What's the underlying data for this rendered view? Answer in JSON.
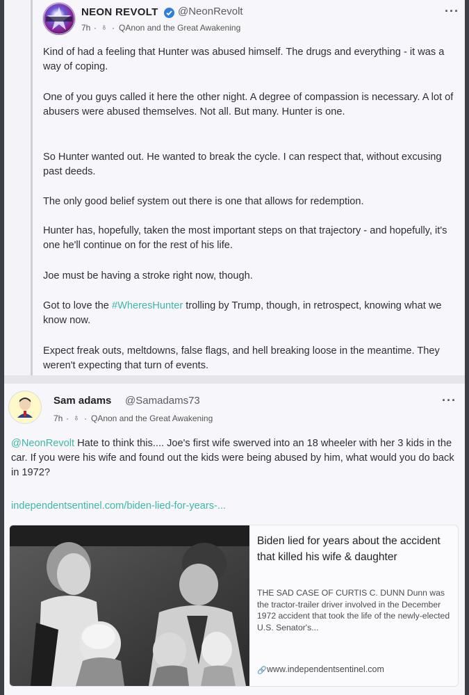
{
  "post1": {
    "author_name": "NEON REVOLT",
    "handle": "@NeonRevolt",
    "time": "7h",
    "separator": "·",
    "group": "QAnon and the Great Awakening",
    "more": "···",
    "paragraphs": [
      "Kind of had a feeling that Hunter was abused himself. The drugs and everything - it was a way of coping.",
      "One of you guys called it here the other night. A degree of compassion is necessary. A lot of abusers were abused themselves. Not all. But many. Hunter is one.",
      "So Hunter wanted out. He wanted to break the cycle. I can respect that, without excusing past deeds.",
      "The only good belief system out there is one that allows for redemption.",
      "Hunter has, hopefully, taken the most important steps on that trajectory - and hopefully, it's one he'll continue on for the rest of his life.",
      "Joe must be having a stroke right now, though."
    ],
    "p7_before": "Got to love the ",
    "p7_hashtag": "#WheresHunter",
    "p7_after": " trolling by Trump, though, in retrospect, knowing what we know now.",
    "p8": "Expect freak outs, meltdowns, false flags, and hell breaking loose in the meantime. They weren't expecting that turn of events."
  },
  "post2": {
    "author_name": "Sam adams",
    "handle": "@Samadams73",
    "time": "7h",
    "separator": "·",
    "group": "QAnon and the Great Awakening",
    "more": "···",
    "mention": "@NeonRevolt",
    "text": " Hate to think this.... Joe's first wife swerved into an 18 wheeler with her 3 kids in the car. If you were his wife and found out the kids were being abused by him, what would you do back in 1972?",
    "link": "independentsentinel.com/biden-lied-for-years-..."
  },
  "card": {
    "title": "Biden lied for years about the accident that killed his wife & daughter",
    "description": "THE SAD CASE OF CURTIS C. DUNN Dunn was the tractor-trailer driver involved in the December 1972 accident that took the life of the newly-elected U.S. Senator's...",
    "url": "www.independentsentinel.com"
  },
  "colors": {
    "link": "#3fb7a8",
    "verified": "#2f7fd8"
  },
  "icons": [
    "verified-badge-icon",
    "group-icon",
    "more-options-icon",
    "link-icon"
  ]
}
